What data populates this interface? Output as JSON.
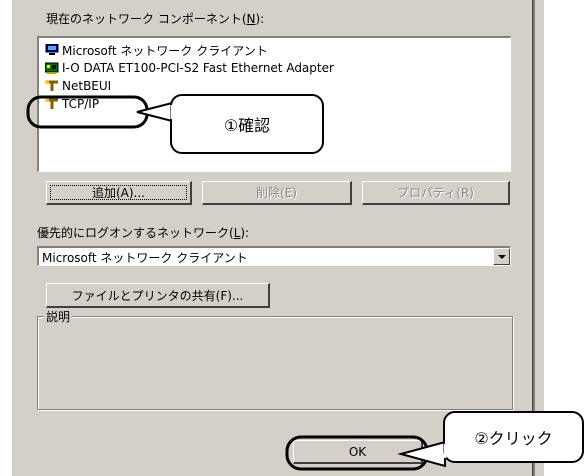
{
  "components_label": "現在のネットワーク コンポーネント(",
  "components_key": "N",
  "components_suffix": "):",
  "components": [
    {
      "label": "Microsoft ネットワーク クライアント",
      "icon": "network-client-icon"
    },
    {
      "label": "I-O DATA ET100-PCI-S2 Fast Ethernet Adapter",
      "icon": "network-adapter-icon"
    },
    {
      "label": "NetBEUI",
      "icon": "protocol-icon"
    },
    {
      "label": "TCP/IP",
      "icon": "protocol-icon"
    }
  ],
  "buttons": {
    "add": "追加(A)...",
    "remove": "削除(E)",
    "properties": "プロパティ(R)",
    "file_print": "ファイルとプリンタの共有(F)...",
    "ok": "OK"
  },
  "logon_label": "優先的にログオンするネットワーク(",
  "logon_key": "L",
  "logon_suffix": "):",
  "logon_value": "Microsoft ネットワーク クライアント",
  "description_label": "説明",
  "callouts": {
    "confirm": "①確認",
    "click": "②クリック"
  },
  "colors": {
    "dialog_bg": "#d4d0c8",
    "list_bg": "#ffffff"
  }
}
